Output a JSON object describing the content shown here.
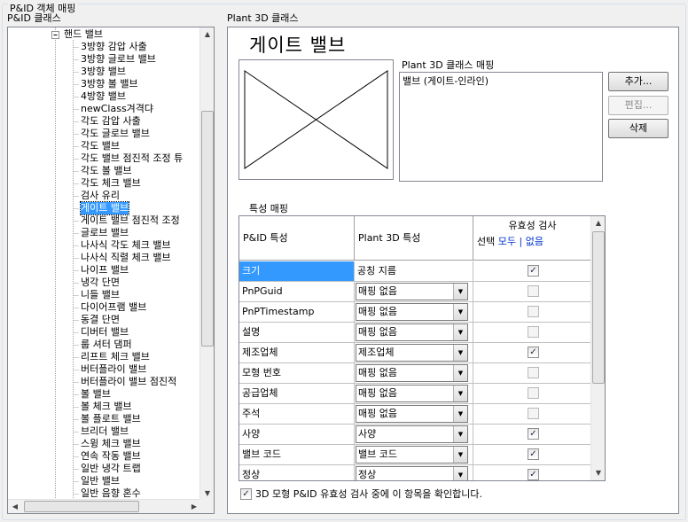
{
  "group_title": "P&ID 객체 매핑",
  "left_label": "P&ID 클래스",
  "right_label": "Plant 3D 클래스",
  "tree": {
    "parent": "핸드 밸브",
    "items": [
      "3방향 감압 사출",
      "3방향 글로브 밸브",
      "3방향 밸브",
      "3방향 볼 밸브",
      "4방향 밸브",
      "newClass겨격댜",
      "각도 감압 사출",
      "각도 글로브 밸브",
      "각도 밸브",
      "각도 밸브 점진적 조정 튜",
      "각도 볼 밸브",
      "각도 체크 밸브",
      "검사 유리",
      "게이트 밸브",
      "게이트 밸브 점진적 조정",
      "글로브 밸브",
      "나사식 각도 체크 밸브",
      "나사식 직렬 체크 밸브",
      "나이프 밸브",
      "냉각 단면",
      "니들 밸브",
      "다이어프램 밸브",
      "동결 단면",
      "디버터 밸브",
      "룹 셔터 댐퍼",
      "리프트 체크 밸브",
      "버터플라이 밸브",
      "버터플라이 밸브 점진적",
      "볼 밸브",
      "볼 체크 밸브",
      "볼 플로트 밸브",
      "브리더 밸브",
      "스윙 체크 밸브",
      "연속 작동 밸브",
      "일반 냉각 트랩",
      "일반 밸브",
      "일반 음향 혼수"
    ],
    "selected": "게이트 밸브"
  },
  "detail": {
    "title": "게이트 밸브",
    "mapping_label": "Plant 3D 클래스 매핑",
    "mapping_items": [
      "밸브 (게이트-인라인)"
    ],
    "buttons": {
      "add": "추가...",
      "edit": "편집...",
      "delete": "삭제"
    }
  },
  "props": {
    "label": "특성 매핑",
    "col_pid": "P&ID 특성",
    "col_plant": "Plant 3D 특성",
    "col_valid": "유효성 검사",
    "select_label": "선택",
    "select_all": "모두",
    "select_sep": "|",
    "select_none": "없음",
    "rows": [
      {
        "pid": "크기",
        "plant": "공칭 지름",
        "combo": false,
        "checked": true,
        "enabled": true
      },
      {
        "pid": "PnPGuid",
        "plant": "매핑 없음",
        "combo": true,
        "checked": false,
        "enabled": false
      },
      {
        "pid": "PnPTimestamp",
        "plant": "매핑 없음",
        "combo": true,
        "checked": false,
        "enabled": false
      },
      {
        "pid": "설명",
        "plant": "매핑 없음",
        "combo": true,
        "checked": false,
        "enabled": false
      },
      {
        "pid": "제조업체",
        "plant": "제조업체",
        "combo": true,
        "checked": true,
        "enabled": true
      },
      {
        "pid": "모형 번호",
        "plant": "매핑 없음",
        "combo": true,
        "checked": false,
        "enabled": false
      },
      {
        "pid": "공급업체",
        "plant": "매핑 없음",
        "combo": true,
        "checked": false,
        "enabled": false
      },
      {
        "pid": "주석",
        "plant": "매핑 없음",
        "combo": true,
        "checked": false,
        "enabled": false
      },
      {
        "pid": "사양",
        "plant": "사양",
        "combo": true,
        "checked": true,
        "enabled": true
      },
      {
        "pid": "밸브 코드",
        "plant": "밸브 코드",
        "combo": true,
        "checked": true,
        "enabled": true
      },
      {
        "pid": "정상",
        "plant": "정상",
        "combo": true,
        "checked": true,
        "enabled": true
      }
    ]
  },
  "bottom_check": {
    "label": "3D 모형 P&ID 유효성 검사 중에 이 항목을 확인합니다.",
    "checked": true
  },
  "colors": {
    "selection": "#3399ff",
    "link": "#0033cc",
    "border": "#828790"
  }
}
